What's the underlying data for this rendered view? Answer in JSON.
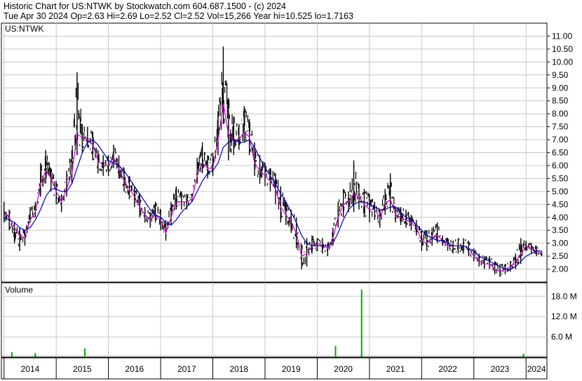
{
  "header": {
    "line1": "Historic Chart for US:NTWK by Stockwatch.com 604.687.1500 - (c) 2024",
    "line2": "Tue Apr 30 2024  Op=2.63  Hi=2.69  Lo=2.52  Cl=2.52  Vol=15,266  Year hi=10.525  lo=1.7163"
  },
  "price_panel_label": "US:NTWK",
  "volume_panel_label": "Volume",
  "colors": {
    "price_bars": "#000000",
    "short_ma": "#cc00cc",
    "long_ma": "#0000cc",
    "volume_bars": "#00aa00",
    "grid": "#c8c8c8",
    "frame": "#000000"
  },
  "chart_data": [
    {
      "type": "line",
      "panel": "price",
      "ylim": [
        1.5,
        11.5
      ],
      "yticks": [
        2.0,
        2.5,
        3.0,
        3.5,
        4.0,
        4.5,
        5.0,
        5.5,
        6.0,
        6.5,
        7.0,
        7.5,
        8.0,
        8.5,
        9.0,
        9.5,
        10.0,
        10.5,
        11.0
      ],
      "ytick_labels": [
        "2.00",
        "2.50",
        "3.00",
        "3.50",
        "4.00",
        "4.50",
        "5.00",
        "5.50",
        "6.00",
        "6.50",
        "7.00",
        "7.50",
        "8.00",
        "8.50",
        "9.00",
        "9.50",
        "10.00",
        "10.50",
        "11.00"
      ],
      "x_axis_years": [
        "2014",
        "2015",
        "2016",
        "2017",
        "2018",
        "2019",
        "2020",
        "2021",
        "2022",
        "2023",
        "2024"
      ],
      "xlim": [
        2013.95,
        2024.4
      ],
      "grid": true,
      "series": [
        {
          "style": "high-low-bars",
          "x": [
            2014.0,
            2014.1,
            2014.2,
            2014.3,
            2014.4,
            2014.5,
            2014.6,
            2014.7,
            2014.8,
            2014.9,
            2015.0,
            2015.1,
            2015.2,
            2015.3,
            2015.4,
            2015.5,
            2015.6,
            2015.7,
            2015.8,
            2015.9,
            2016.0,
            2016.1,
            2016.2,
            2016.3,
            2016.4,
            2016.5,
            2016.6,
            2016.7,
            2016.8,
            2016.9,
            2017.0,
            2017.1,
            2017.2,
            2017.3,
            2017.4,
            2017.5,
            2017.6,
            2017.7,
            2017.8,
            2017.9,
            2018.0,
            2018.1,
            2018.2,
            2018.3,
            2018.4,
            2018.5,
            2018.6,
            2018.7,
            2018.8,
            2018.9,
            2019.0,
            2019.1,
            2019.2,
            2019.3,
            2019.4,
            2019.5,
            2019.6,
            2019.7,
            2019.8,
            2019.9,
            2020.0,
            2020.1,
            2020.2,
            2020.3,
            2020.4,
            2020.5,
            2020.6,
            2020.7,
            2020.8,
            2020.9,
            2021.0,
            2021.1,
            2021.2,
            2021.3,
            2021.4,
            2021.5,
            2021.6,
            2021.7,
            2021.8,
            2021.9,
            2022.0,
            2022.1,
            2022.2,
            2022.3,
            2022.4,
            2022.5,
            2022.6,
            2022.7,
            2022.8,
            2022.9,
            2023.0,
            2023.1,
            2023.2,
            2023.3,
            2023.4,
            2023.5,
            2023.6,
            2023.7,
            2023.8,
            2023.9,
            2024.0,
            2024.1,
            2024.2,
            2024.3
          ],
          "high": [
            4.6,
            4.3,
            3.8,
            3.6,
            3.5,
            4.4,
            4.6,
            6.1,
            6.6,
            5.9,
            5.4,
            4.9,
            5.8,
            6.6,
            9.6,
            7.6,
            7.5,
            7.3,
            6.6,
            6.4,
            6.4,
            6.8,
            6.4,
            5.9,
            5.6,
            5.2,
            4.9,
            4.4,
            4.2,
            4.6,
            4.3,
            3.9,
            4.6,
            5.2,
            5.0,
            4.9,
            4.9,
            6.3,
            6.9,
            6.4,
            6.5,
            8.1,
            10.6,
            8.6,
            7.9,
            7.6,
            8.3,
            7.8,
            6.9,
            6.4,
            6.1,
            5.9,
            5.7,
            5.2,
            4.6,
            4.3,
            4.0,
            2.9,
            3.2,
            3.3,
            3.2,
            3.2,
            3.0,
            3.6,
            4.6,
            5.1,
            5.0,
            6.2,
            5.3,
            5.1,
            4.9,
            4.6,
            4.3,
            5.1,
            5.7,
            4.4,
            4.4,
            4.3,
            4.1,
            3.9,
            3.5,
            3.5,
            3.6,
            3.8,
            3.3,
            3.2,
            3.1,
            3.2,
            3.2,
            3.1,
            2.8,
            2.6,
            2.5,
            2.5,
            2.3,
            2.2,
            2.2,
            2.3,
            2.6,
            3.2,
            3.1,
            3.0,
            2.9,
            2.7
          ],
          "low": [
            3.8,
            3.5,
            3.0,
            2.7,
            2.9,
            3.8,
            4.0,
            4.8,
            5.3,
            5.0,
            4.5,
            4.2,
            4.8,
            5.3,
            6.4,
            6.5,
            6.7,
            6.2,
            5.7,
            5.6,
            5.6,
            5.9,
            5.5,
            5.0,
            4.7,
            4.4,
            4.0,
            3.8,
            3.6,
            3.8,
            3.5,
            3.1,
            3.7,
            4.3,
            4.3,
            4.3,
            4.6,
            5.3,
            5.7,
            5.5,
            5.6,
            6.4,
            7.6,
            6.2,
            6.4,
            6.6,
            6.9,
            6.4,
            5.6,
            5.3,
            5.2,
            5.0,
            4.5,
            3.8,
            3.7,
            3.4,
            2.8,
            2.0,
            2.1,
            2.6,
            2.7,
            2.6,
            2.5,
            2.9,
            3.6,
            4.0,
            4.2,
            4.2,
            4.3,
            4.0,
            3.8,
            3.9,
            3.6,
            4.1,
            4.2,
            3.8,
            3.7,
            3.6,
            3.5,
            3.3,
            2.7,
            2.7,
            2.9,
            3.0,
            2.9,
            2.7,
            2.6,
            2.6,
            2.6,
            2.5,
            2.3,
            2.1,
            2.0,
            2.0,
            1.8,
            1.7,
            1.8,
            1.9,
            2.0,
            2.2,
            2.7,
            2.6,
            2.5,
            2.5
          ]
        },
        {
          "style": "moving-average-short",
          "values": [
            4.2,
            4.0,
            3.6,
            3.3,
            3.2,
            3.9,
            4.2,
            5.3,
            5.8,
            5.5,
            5.0,
            4.6,
            5.1,
            5.7,
            7.2,
            7.1,
            7.0,
            6.8,
            6.2,
            6.0,
            6.0,
            6.3,
            5.9,
            5.4,
            5.1,
            4.8,
            4.4,
            4.1,
            3.9,
            4.1,
            3.9,
            3.4,
            4.0,
            4.6,
            4.6,
            4.6,
            4.7,
            5.6,
            6.1,
            5.9,
            5.9,
            7.0,
            8.4,
            7.2,
            7.0,
            7.0,
            7.3,
            7.1,
            6.1,
            5.8,
            5.6,
            5.4,
            5.1,
            4.4,
            4.1,
            3.8,
            3.4,
            2.5,
            2.6,
            2.9,
            3.0,
            2.9,
            2.8,
            3.2,
            4.0,
            4.5,
            4.6,
            4.9,
            4.8,
            4.5,
            4.3,
            4.3,
            4.0,
            4.5,
            4.7,
            4.1,
            4.0,
            3.9,
            3.8,
            3.6,
            3.1,
            3.0,
            3.2,
            3.3,
            3.1,
            2.9,
            2.9,
            2.9,
            2.9,
            2.8,
            2.5,
            2.3,
            2.2,
            2.2,
            2.0,
            1.9,
            2.0,
            2.1,
            2.3,
            2.6,
            2.9,
            2.8,
            2.7,
            2.6
          ]
        },
        {
          "style": "moving-average-long",
          "values": [
            4.0,
            3.9,
            3.8,
            3.6,
            3.5,
            3.6,
            3.9,
            4.3,
            4.8,
            5.1,
            5.1,
            5.0,
            5.0,
            5.3,
            5.9,
            6.5,
            6.9,
            7.0,
            6.8,
            6.5,
            6.2,
            6.1,
            6.0,
            5.8,
            5.5,
            5.2,
            4.9,
            4.6,
            4.3,
            4.1,
            4.0,
            3.8,
            3.7,
            3.9,
            4.2,
            4.4,
            4.6,
            5.0,
            5.4,
            5.7,
            5.8,
            6.1,
            6.7,
            6.9,
            7.0,
            6.9,
            6.9,
            7.0,
            6.7,
            6.3,
            5.9,
            5.6,
            5.3,
            4.9,
            4.6,
            4.2,
            3.8,
            3.3,
            3.0,
            2.9,
            2.9,
            2.9,
            2.9,
            3.0,
            3.4,
            3.9,
            4.3,
            4.5,
            4.6,
            4.6,
            4.5,
            4.4,
            4.3,
            4.3,
            4.4,
            4.4,
            4.2,
            4.0,
            3.9,
            3.7,
            3.5,
            3.3,
            3.2,
            3.1,
            3.1,
            3.0,
            2.9,
            2.9,
            2.9,
            2.8,
            2.7,
            2.5,
            2.4,
            2.3,
            2.2,
            2.1,
            2.0,
            2.0,
            2.1,
            2.3,
            2.5,
            2.6,
            2.7,
            2.7
          ]
        }
      ]
    },
    {
      "type": "bar",
      "panel": "volume",
      "ylabel": "Volume",
      "ylim": [
        0,
        22
      ],
      "yticks": [
        6.0,
        12.0,
        18.0
      ],
      "ytick_labels": [
        "6.0 M",
        "12.0 M",
        "18.0 M"
      ],
      "baseline_value": 0.5,
      "spikes": [
        {
          "x": 2014.15,
          "value": 1.5
        },
        {
          "x": 2014.6,
          "value": 1.2
        },
        {
          "x": 2015.55,
          "value": 2.6
        },
        {
          "x": 2020.35,
          "value": 3.3
        },
        {
          "x": 2020.85,
          "value": 20.0
        },
        {
          "x": 2023.95,
          "value": 1.0
        }
      ]
    }
  ]
}
